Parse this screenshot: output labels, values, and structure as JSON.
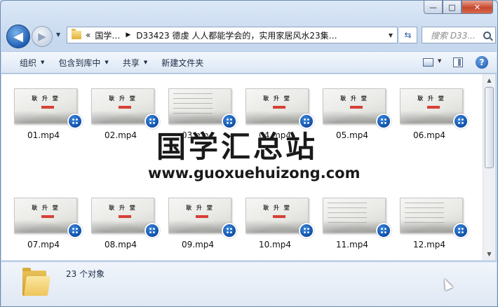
{
  "window": {
    "caption_buttons": {
      "minimize": "—",
      "maximize": "□",
      "close": "✕"
    }
  },
  "nav": {
    "address_prefix": "«",
    "breadcrumb": [
      "国学…",
      "D33423 德虔 人人都能学会的，实用家居风水23集…"
    ],
    "search_placeholder": "搜索 D33..."
  },
  "toolbar": {
    "organize": "组织",
    "include_in_library": "包含到库中",
    "share": "共享",
    "new_folder": "新建文件夹",
    "help": "?"
  },
  "files": [
    {
      "name": "01.mp4",
      "variant": "title",
      "title": "耿 升 堂",
      "subtitle": "家居 风水学"
    },
    {
      "name": "02.mp4",
      "variant": "title",
      "title": "耿 升 堂",
      "subtitle": "家居 风水学"
    },
    {
      "name": "03.mp4",
      "variant": "text",
      "title": "",
      "subtitle": ""
    },
    {
      "name": "04.mp4",
      "variant": "title",
      "title": "耿 升 堂",
      "subtitle": "家居 风水学"
    },
    {
      "name": "05.mp4",
      "variant": "title",
      "title": "耿 升 堂",
      "subtitle": "家居 风水学"
    },
    {
      "name": "06.mp4",
      "variant": "title",
      "title": "耿 升 堂",
      "subtitle": "家居 风水学"
    },
    {
      "name": "07.mp4",
      "variant": "title",
      "title": "耿 升 堂",
      "subtitle": "家居 风水学"
    },
    {
      "name": "08.mp4",
      "variant": "title",
      "title": "耿 升 堂",
      "subtitle": "家居 风水学"
    },
    {
      "name": "09.mp4",
      "variant": "title",
      "title": "耿 升 堂",
      "subtitle": "家居 风水学"
    },
    {
      "name": "10.mp4",
      "variant": "title",
      "title": "耿 升 堂",
      "subtitle": "家居 风水学"
    },
    {
      "name": "11.mp4",
      "variant": "text",
      "title": "",
      "subtitle": ""
    },
    {
      "name": "12.mp4",
      "variant": "text",
      "title": "",
      "subtitle": ""
    }
  ],
  "watermark": {
    "title": "国学汇总站",
    "url": "www.guoxuehuizong.com"
  },
  "status": {
    "count_text": "23 个对象"
  }
}
